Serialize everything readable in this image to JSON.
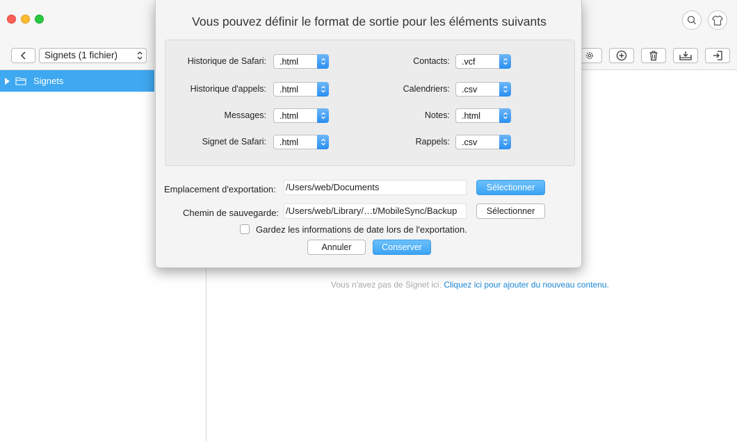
{
  "window": {
    "colors": {
      "close": "#fc5f57",
      "minimize": "#fdbc2e",
      "maximize": "#28c840",
      "accent": "#3ea8f0"
    }
  },
  "header_icons": [
    "search-icon",
    "tshirt-icon"
  ],
  "toolbar": {
    "back_icon": "chevron-left-icon",
    "category_select": "Signets (1 fichier)",
    "tools": [
      "gear-icon",
      "add-icon",
      "trash-icon",
      "download-icon",
      "export-icon"
    ]
  },
  "sidebar": {
    "items": [
      {
        "label": "Signets",
        "icon": "folder-icon",
        "selected": true
      }
    ]
  },
  "content": {
    "empty_text": "Vous n'avez pas de Signet ici.",
    "empty_link": "Cliquez ici pour ajouter du nouveau contenu."
  },
  "dialog": {
    "title": "Vous pouvez définir le format de sortie pour les éléments suivants",
    "formats_left": [
      {
        "label": "Historique de Safari:",
        "value": ".html"
      },
      {
        "label": "Historique d'appels:",
        "value": ".html"
      },
      {
        "label": "Messages:",
        "value": ".html"
      },
      {
        "label": "Signet de Safari:",
        "value": ".html"
      }
    ],
    "formats_right": [
      {
        "label": "Contacts:",
        "value": ".vcf"
      },
      {
        "label": "Calendriers:",
        "value": ".csv"
      },
      {
        "label": "Notes:",
        "value": ".html"
      },
      {
        "label": "Rappels:",
        "value": ".csv"
      }
    ],
    "export_location": {
      "label": "Emplacement d'exportation:",
      "value": "/Users/web/Documents",
      "button": "Sélectionner"
    },
    "save_path": {
      "label": "Chemin de sauvegarde:",
      "value": "/Users/web/Library/…t/MobileSync/Backup",
      "button": "Sélectionner"
    },
    "keep_date": {
      "label": "Gardez les informations de date lors de l'exportation.",
      "checked": false
    },
    "cancel_label": "Annuler",
    "save_label": "Conserver"
  }
}
